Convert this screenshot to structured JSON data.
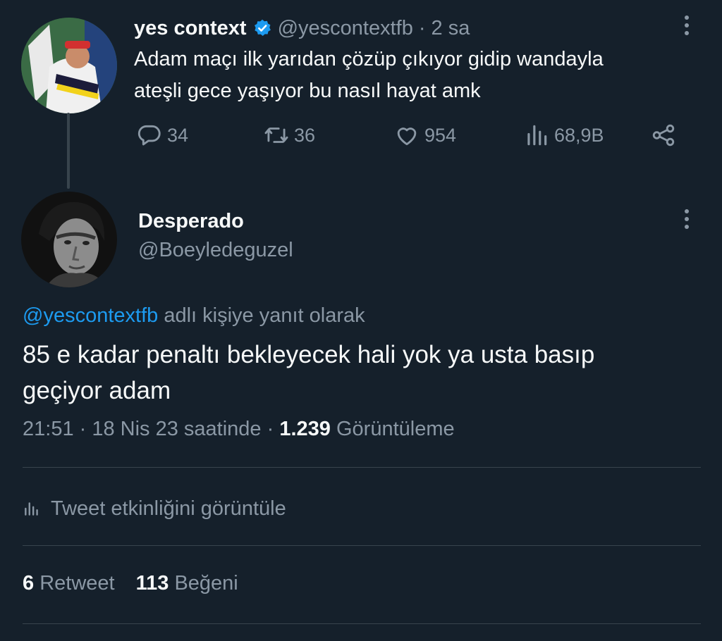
{
  "parent_tweet": {
    "display_name": "yes context",
    "handle": "@yescontextfb",
    "time": "· 2 sa",
    "text_line1": "Adam maçı ilk yarıdan çözüp çıkıyor gidip wandayla",
    "text_line2": "ateşli gece yaşıyor bu nasıl hayat amk",
    "replies": "34",
    "retweets": "36",
    "likes": "954",
    "views": "68,9B"
  },
  "main_tweet": {
    "display_name": "Desperado",
    "handle": "@Boeyledeguzel",
    "reply_to_handle": "@yescontextfb",
    "reply_to_suffix": "adlı kişiye yanıt olarak",
    "text_line1": "85 e kadar penaltı bekleyecek hali yok ya usta basıp",
    "text_line2": "geçiyor adam",
    "time": "21:51 · 18 Nis 23 saatinde ·",
    "view_count": "1.239",
    "view_label": "Görüntüleme",
    "activity_label": "Tweet etkinliğini görüntüle",
    "retweet_count": "6",
    "retweet_label": "Retweet",
    "like_count": "113",
    "like_label": "Beğeni"
  },
  "colors": {
    "background": "#15202b",
    "text": "#f7f9f9",
    "muted": "#8b98a5",
    "accent": "#1d9bf0",
    "divider": "#38444d"
  }
}
